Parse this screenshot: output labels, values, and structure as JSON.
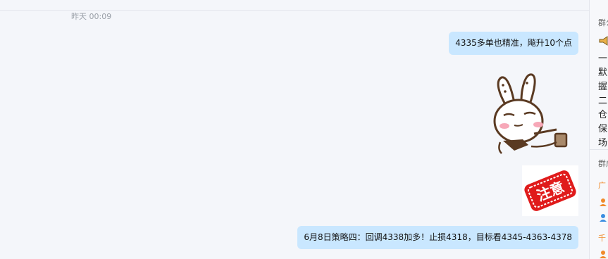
{
  "chat": {
    "timestamp": "昨天 00:09",
    "messages": [
      {
        "text": "4335多单也精准，飚升10个点"
      },
      {
        "sticker": "rabbit-sticker"
      },
      {
        "sticker": "stamp-sticker",
        "stamp_text": "注意"
      },
      {
        "text": "6月8日策略四：回调4338加多！止损4318，目标看4345-4363-4378"
      }
    ]
  },
  "sidebar": {
    "notice_title": "群公告",
    "notice_lines": [
      "一",
      "默",
      "握",
      "二",
      "仓",
      "保",
      "场"
    ],
    "members_title": "群成员",
    "members": [
      {
        "label": "广"
      },
      {
        "label": "千"
      }
    ]
  },
  "colors": {
    "bubble": "#c9e7ff",
    "background": "#f4f6fa",
    "stamp_red": "#e01b1b",
    "member_orange": "#f08a2b"
  }
}
